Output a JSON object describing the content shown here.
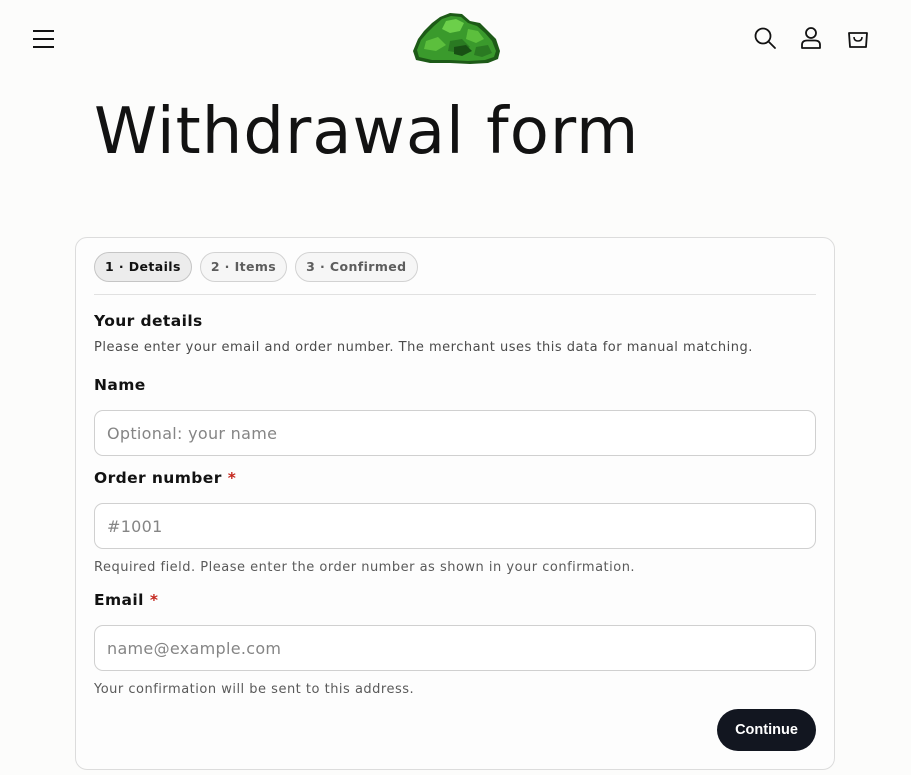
{
  "header": {
    "menu_icon": "hamburger-menu-icon",
    "logo_icon": "green-bush-logo-icon",
    "search_icon": "search-icon",
    "account_icon": "account-icon",
    "cart_icon": "cart-icon"
  },
  "page": {
    "title": "Withdrawal form"
  },
  "steps": [
    {
      "label": "1 · Details",
      "active": true
    },
    {
      "label": "2 · Items",
      "active": false
    },
    {
      "label": "3 · Confirmed",
      "active": false
    }
  ],
  "form": {
    "section_title": "Your details",
    "section_description": "Please enter your email and order number. The merchant uses this data for manual matching.",
    "name": {
      "label": "Name",
      "placeholder": "Optional: your name",
      "value": ""
    },
    "order_number": {
      "label": "Order number",
      "required_mark": "*",
      "placeholder": "#1001",
      "value": "",
      "hint": "Required field. Please enter the order number as shown in your confirmation."
    },
    "email": {
      "label": "Email",
      "required_mark": "*",
      "placeholder": "name@example.com",
      "value": "",
      "hint": "Your confirmation will be sent to this address."
    },
    "continue_label": "Continue"
  },
  "colors": {
    "background": "#fcfcfb",
    "text": "#121212",
    "required": "#c4261d",
    "button": "#121620",
    "logo_green": "#3a9a2c"
  }
}
